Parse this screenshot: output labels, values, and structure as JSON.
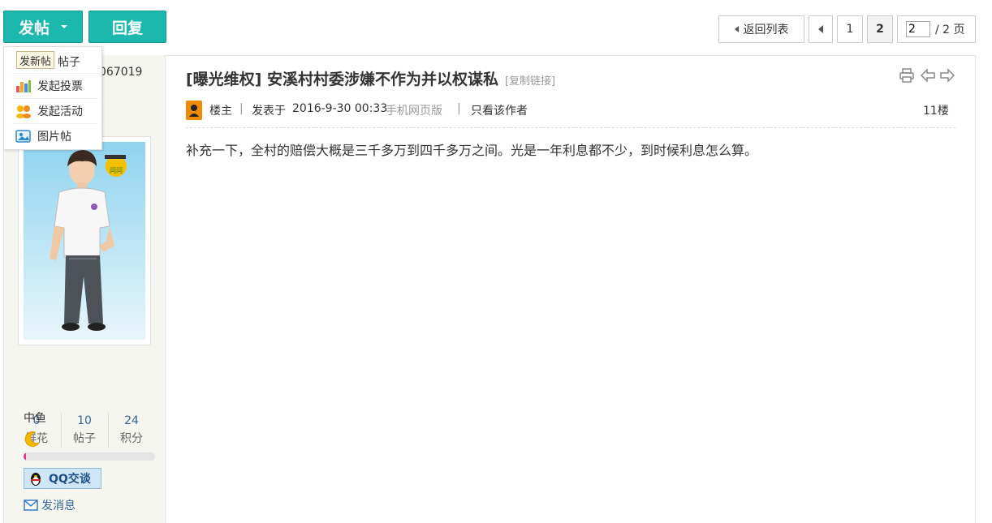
{
  "toolbar": {
    "newpost_label": "发帖",
    "reply_label": "回复"
  },
  "dropdown": {
    "tooltip": "发新帖",
    "items": [
      {
        "label": "帖子",
        "icon": "post-icon"
      },
      {
        "label": "发起投票",
        "icon": "poll-chart-icon"
      },
      {
        "label": "发起活动",
        "icon": "people-group-icon"
      },
      {
        "label": "图片帖",
        "icon": "picture-icon"
      }
    ]
  },
  "pagination": {
    "back_label": "返回列表",
    "pages": [
      "1",
      "2"
    ],
    "current_page": "2",
    "input_value": "2",
    "total_label": "/ 2 页"
  },
  "author": {
    "id_partial": "067019",
    "stats": [
      {
        "value": "0",
        "label": "鲜花"
      },
      {
        "value": "10",
        "label": "帖子"
      },
      {
        "value": "24",
        "label": "积分"
      }
    ],
    "rank": "中鱼",
    "rank_progress": 0.02,
    "qq_label": "QQ交谈",
    "message_label": "发消息",
    "avatar_badge": "问问"
  },
  "post": {
    "title": "[曝光维权] 安溪村村委涉嫌不作为并以权谋私",
    "copy_link": "[复制链接]",
    "role": "楼主",
    "posted_prefix": "发表于",
    "datetime": "2016-9-30 00:33",
    "client": "手机网页版",
    "only_author": "只看该作者",
    "floor": "11楼",
    "content": "补充一下，全村的赔偿大概是三千多万到四千多万之间。光是一年利息都不少，到时候利息怎么算。"
  },
  "colors": {
    "accent": "#1cb8ad",
    "sidebar_bg": "#f4f6ef",
    "link_blue": "#336699"
  }
}
